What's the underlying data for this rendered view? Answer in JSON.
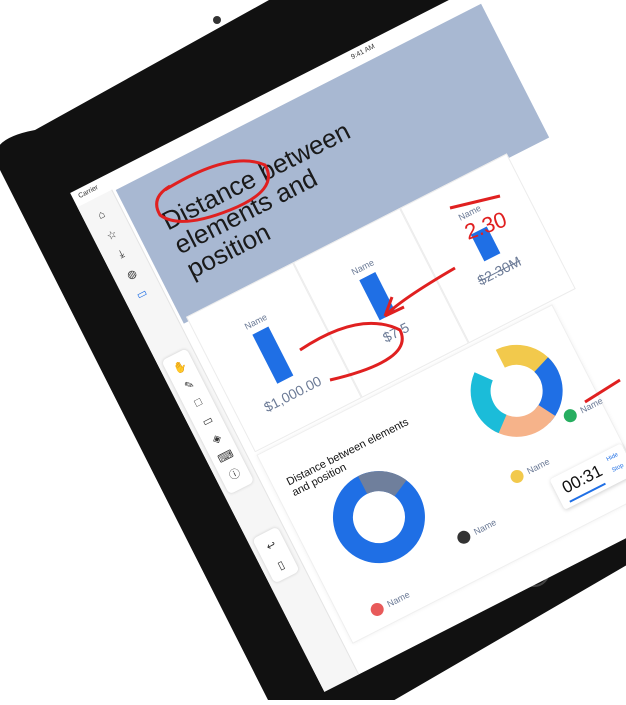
{
  "status": {
    "carrier": "Carrier",
    "time": "9:41 AM"
  },
  "hero": {
    "title": "Distance between elements and position"
  },
  "cards": [
    {
      "label": "Name",
      "value": "$1,000.00"
    },
    {
      "label": "Name",
      "value": "$7.5"
    },
    {
      "label": "Name",
      "value": "$2.30M"
    }
  ],
  "annotation_text": "2.30",
  "chart_card": {
    "title": "Distance between elements and position",
    "legend": [
      {
        "label": "Name",
        "color": "#e85a5a"
      },
      {
        "label": "Name",
        "color": "#333333"
      }
    ]
  },
  "donut2": {
    "legend": [
      {
        "label": "Name",
        "color": "#f2c94c"
      },
      {
        "label": "Name",
        "color": "#27ae60"
      }
    ]
  },
  "timer": {
    "value": "00:31",
    "hide": "Hide",
    "stop": "Stop"
  },
  "toolbar": {
    "items": [
      "home-icon",
      "star-icon",
      "download-icon",
      "globe-icon",
      "tablet-icon"
    ],
    "draw_tools": [
      "hand-icon",
      "pencil-icon",
      "square-icon",
      "video-icon",
      "layers-icon",
      "keyboard-icon",
      "info-icon"
    ],
    "bottom_tools": [
      "undo-icon",
      "page-icon"
    ]
  },
  "colors": {
    "accent": "#1f6fe5",
    "hero_bg": "#a8b8d2",
    "annotation_red": "#e02020"
  }
}
